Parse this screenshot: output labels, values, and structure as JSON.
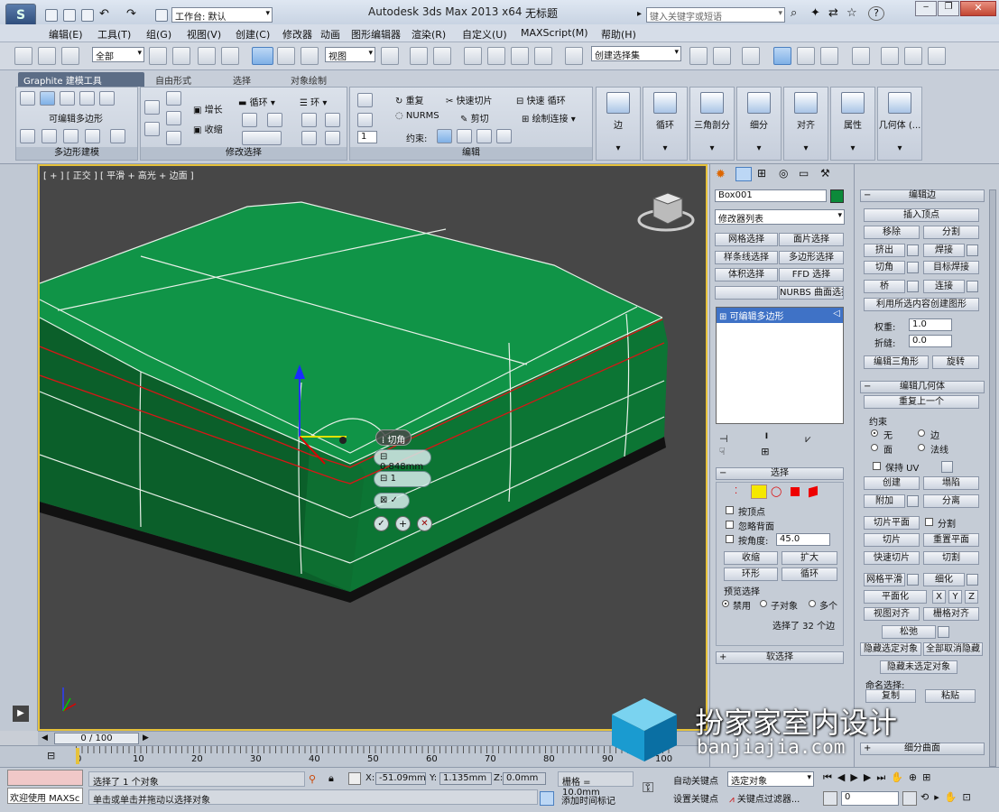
{
  "app": {
    "title": "Autodesk 3ds Max  2013 x64",
    "doc_title": "无标题",
    "workspace_label": "工作台: 默认",
    "search_placeholder": "键入关键字或短语"
  },
  "menu": [
    "编辑(E)",
    "工具(T)",
    "组(G)",
    "视图(V)",
    "创建(C)",
    "修改器",
    "动画",
    "图形编辑器",
    "渲染(R)",
    "自定义(U)",
    "MAXScript(M)",
    "帮助(H)"
  ],
  "toolbar": {
    "filter": "全部",
    "ref_coord": "视图",
    "selection_set": "创建选择集"
  },
  "ribbon": {
    "tabs": [
      "Graphite 建模工具",
      "自由形式",
      "选择",
      "对象绘制"
    ],
    "group_poly_label": "可编辑多边形",
    "group_poly_footer": "多边形建模",
    "modify_sel": {
      "grow": "增长",
      "shrink": "收缩",
      "loop": "循环",
      "ring": "环",
      "footer": "修改选择"
    },
    "edit": {
      "repeat": "重复",
      "quickslice": "快速切片",
      "quickloop": "快速 循环",
      "nurms": "NURMS",
      "cut": "剪切",
      "paint_connect": "绘制连接",
      "constraints": "约束:",
      "footer": "编辑",
      "spinner": "1"
    },
    "big_buttons": [
      "边",
      "循环",
      "三角剖分",
      "细分",
      "对齐",
      "属性",
      "几何体 (..."
    ]
  },
  "viewport": {
    "label": "[ + ] [ 正交 ] [ 平滑 + 高光 + 边面 ]",
    "caddy": {
      "title": "切角",
      "amount": "0.848mm",
      "segments": "1"
    }
  },
  "cmd": {
    "object_name": "Box001",
    "modifier_list": "修改器列表",
    "modsets": [
      "网格选择",
      "面片选择",
      "样条线选择",
      "多边形选择",
      "体积选择",
      "FFD 选择",
      "",
      "NURBS 曲面选择"
    ],
    "stack_item": "可编辑多边形",
    "selection": {
      "title": "选择",
      "by_vertex": "按顶点",
      "ignore_back": "忽略背面",
      "by_angle": "按角度:",
      "angle": "45.0",
      "shrink": "收缩",
      "grow": "扩大",
      "ring": "环形",
      "loop": "循环",
      "preview": "预览选择",
      "disable": "禁用",
      "subobj": "子对象",
      "multi": "多个",
      "status": "选择了 32 个边"
    },
    "soft_sel": "软选择"
  },
  "edit_edges": {
    "title": "编辑边",
    "insert_vertex": "插入顶点",
    "remove": "移除",
    "split": "分割",
    "extrude": "挤出",
    "weld": "焊接",
    "chamfer": "切角",
    "target_weld": "目标焊接",
    "bridge": "桥",
    "connect": "连接",
    "create_shape": "利用所选内容创建图形",
    "weight_label": "权重:",
    "weight": "1.0",
    "crease_label": "折缝:",
    "crease": "0.0",
    "edit_tri": "编辑三角形",
    "turn": "旋转"
  },
  "edit_geom": {
    "title": "编辑几何体",
    "repeat_last": "重复上一个",
    "constraints": "约束",
    "c_none": "无",
    "c_edge": "边",
    "c_face": "面",
    "c_normal": "法线",
    "keep_uv": "保持 UV",
    "create": "创建",
    "collapse": "塌陷",
    "attach": "附加",
    "detach": "分离",
    "slice_plane": "切片平面",
    "split": "分割",
    "slice": "切片",
    "reset_plane": "重置平面",
    "quickslice": "快速切片",
    "cut": "切割",
    "meshsmooth": "网格平滑",
    "tessellate": "细化",
    "make_planar": "平面化",
    "x": "X",
    "y": "Y",
    "z": "Z",
    "view_align": "视图对齐",
    "grid_align": "栅格对齐",
    "relax": "松弛",
    "hide_sel": "隐藏选定对象",
    "unhide_all": "全部取消隐藏",
    "hide_unsel": "隐藏未选定对象",
    "named_sel": "命名选择:",
    "copy": "复制",
    "paste": "粘贴",
    "subdiv_surface": "细分曲面"
  },
  "timeline": {
    "frame": "0 / 100",
    "ticks": [
      "0",
      "10",
      "20",
      "30",
      "40",
      "50",
      "60",
      "70",
      "80",
      "90",
      "100"
    ]
  },
  "status": {
    "welcome": "欢迎使用 MAXSc",
    "selected": "选择了 1 个对象",
    "prompt": "单击或单击并拖动以选择对象",
    "x_label": "X:",
    "x": "-51.09mm",
    "y_label": "Y:",
    "y": "1.135mm",
    "z_label": "Z:",
    "z": "0.0mm",
    "grid": "栅格 = 10.0mm",
    "add_time_tag": "添加时间标记",
    "auto_key": "自动关键点",
    "set_key": "设置关键点",
    "selected_obj": "选定对象",
    "key_filters": "关键点过滤器...",
    "frame_field": "0"
  },
  "watermark": {
    "cn": "扮家家室内设计",
    "url": "banjiajia.com"
  },
  "colors": {
    "object_green": "#0c8a3a",
    "viewport_bg": "#474747",
    "frame_yellow": "#e6c23a"
  }
}
